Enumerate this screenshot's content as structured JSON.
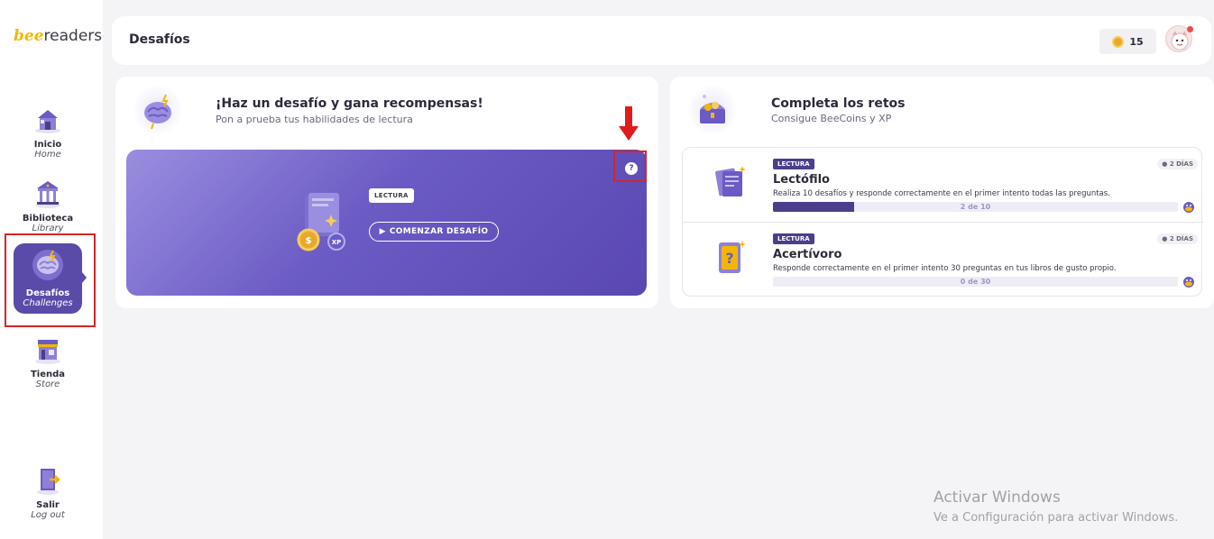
{
  "app": {
    "logo_prefix": "bee",
    "logo_suffix": "readers"
  },
  "sidebar": {
    "items": [
      {
        "label": "Inicio",
        "sub": "Home",
        "icon": "home-icon"
      },
      {
        "label": "Biblioteca",
        "sub": "Library",
        "icon": "library-icon"
      },
      {
        "label": "Desafíos",
        "sub": "Challenges",
        "icon": "brain-icon",
        "active": true
      },
      {
        "label": "Tienda",
        "sub": "Store",
        "icon": "store-icon"
      },
      {
        "label": "Salir",
        "sub": "Log out",
        "icon": "logout-icon"
      }
    ]
  },
  "header": {
    "title": "Desafíos",
    "coins": "15"
  },
  "challenge": {
    "title": "¡Haz un desafío y gana recompensas!",
    "subtitle": "Pon a prueba tus habilidades de lectura",
    "tag": "LECTURA",
    "start_label": "COMENZAR DESAFÍO",
    "help_label": "?"
  },
  "retos": {
    "title": "Completa los retos",
    "subtitle": "Consigue BeeCoins y XP",
    "items": [
      {
        "tag": "LECTURA",
        "days": "2 DÍAS",
        "name": "Lectófilo",
        "desc": "Realiza 10 desafíos y responde correctamente en el primer intento todas las preguntas.",
        "progress_text": "2 de 10",
        "progress": 0.2
      },
      {
        "tag": "LECTURA",
        "days": "2 DÍAS",
        "name": "Acertívoro",
        "desc": "Responde correctamente en el primer intento 30 preguntas en tus libros de gusto propio.",
        "progress_text": "0 de 30",
        "progress": 0
      }
    ]
  },
  "watermark": {
    "title": "Activar Windows",
    "subtitle": "Ve a Configuración para activar Windows."
  },
  "colors": {
    "accent": "#5a4ba8",
    "highlight": "#d62525",
    "coin": "#e8a92a"
  }
}
